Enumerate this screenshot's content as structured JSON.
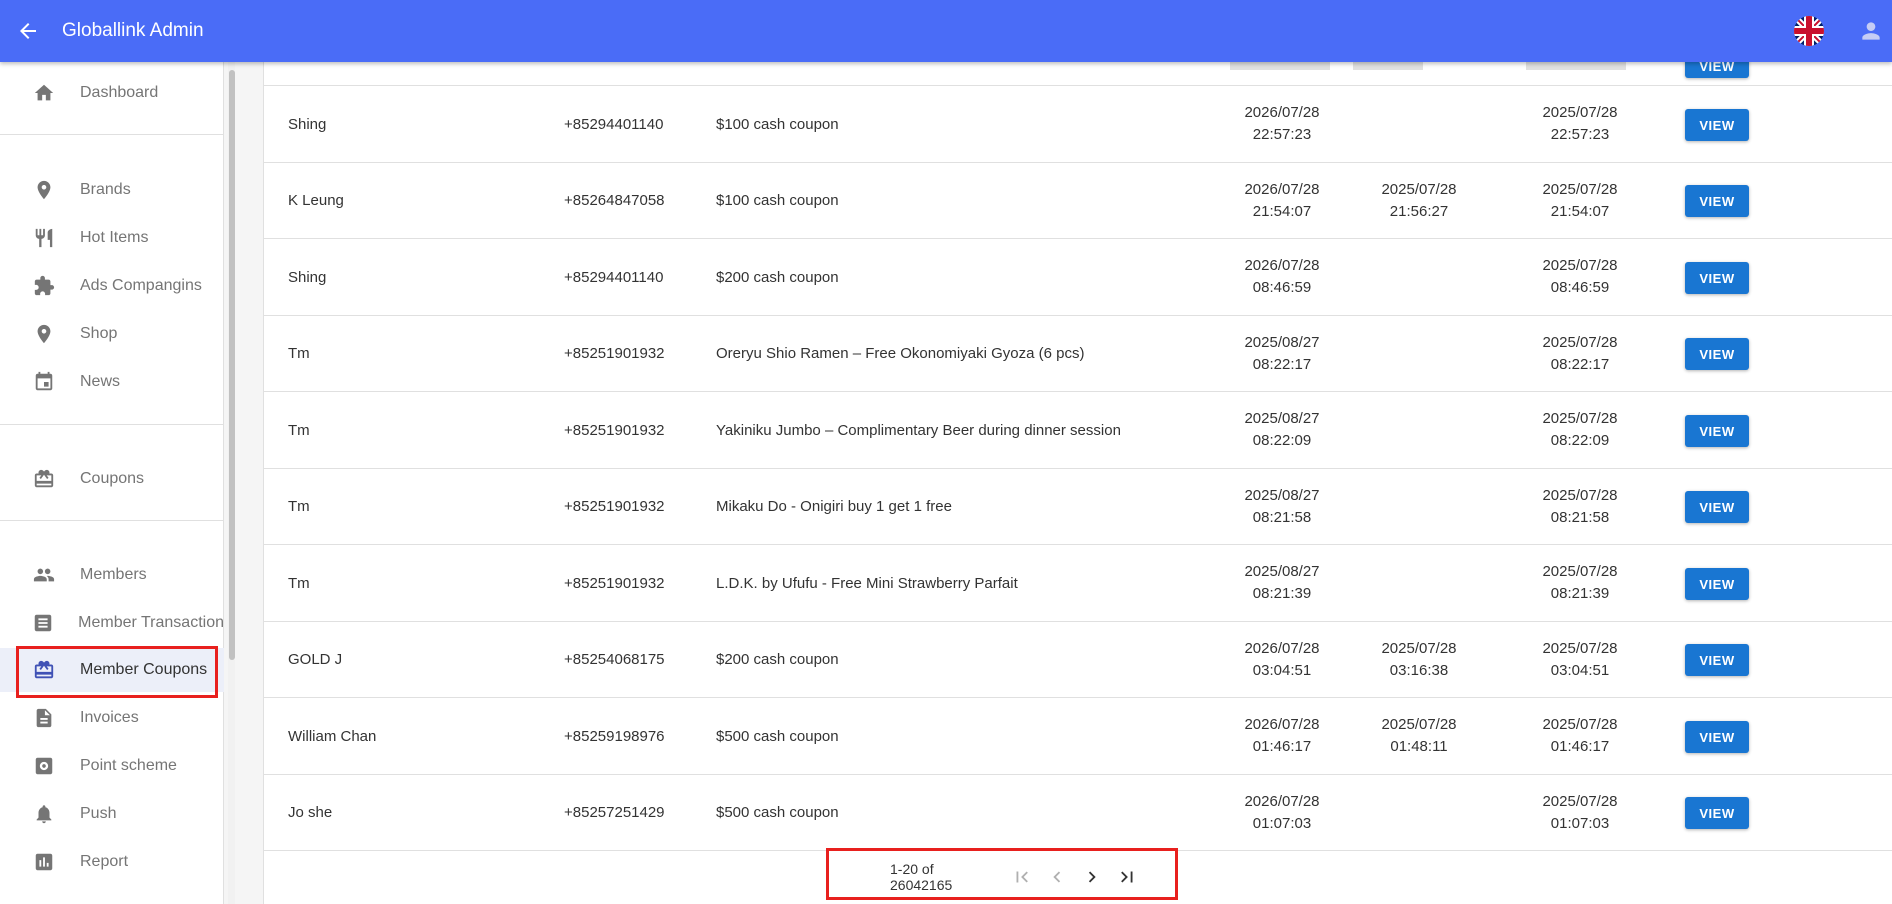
{
  "app": {
    "title": "Globallink Admin"
  },
  "header": {
    "back_icon": "arrow-left-icon",
    "flag_icon": "uk-flag-icon",
    "user_icon": "user-icon"
  },
  "sidebar": {
    "items": [
      {
        "label": "Dashboard",
        "icon": "home-icon"
      },
      {
        "label": "Brands",
        "icon": "location-pin-icon"
      },
      {
        "label": "Hot Items",
        "icon": "restaurant-icon"
      },
      {
        "label": "Ads Compangins",
        "icon": "puzzle-icon"
      },
      {
        "label": "Shop",
        "icon": "location-pin-icon"
      },
      {
        "label": "News",
        "icon": "calendar-icon"
      },
      {
        "label": "Coupons",
        "icon": "gift-card-icon"
      },
      {
        "label": "Members",
        "icon": "people-icon"
      },
      {
        "label": "Member Transaction",
        "icon": "list-icon"
      },
      {
        "label": "Member Coupons",
        "icon": "gift-card-icon",
        "active": true
      },
      {
        "label": "Invoices",
        "icon": "document-icon"
      },
      {
        "label": "Point scheme",
        "icon": "settings-box-icon"
      },
      {
        "label": "Push",
        "icon": "bell-icon"
      },
      {
        "label": "Report",
        "icon": "bar-chart-icon"
      }
    ]
  },
  "table": {
    "button_label": "VIEW",
    "rows": [
      {
        "name": "Shing",
        "phone": "+85294401140",
        "coupon": "$100 cash coupon",
        "expiry": [
          "2026/07/28",
          "22:57:23"
        ],
        "used": [
          "",
          ""
        ],
        "created": [
          "2025/07/28",
          "22:57:23"
        ]
      },
      {
        "name": "K Leung",
        "phone": "+85264847058",
        "coupon": "$100 cash coupon",
        "expiry": [
          "2026/07/28",
          "21:54:07"
        ],
        "used": [
          "2025/07/28",
          "21:56:27"
        ],
        "created": [
          "2025/07/28",
          "21:54:07"
        ]
      },
      {
        "name": "Shing",
        "phone": "+85294401140",
        "coupon": "$200 cash coupon",
        "expiry": [
          "2026/07/28",
          "08:46:59"
        ],
        "used": [
          "",
          ""
        ],
        "created": [
          "2025/07/28",
          "08:46:59"
        ]
      },
      {
        "name": "Tm",
        "phone": "+85251901932",
        "coupon": "Oreryu Shio Ramen – Free Okonomiyaki Gyoza (6 pcs)",
        "expiry": [
          "2025/08/27",
          "08:22:17"
        ],
        "used": [
          "",
          ""
        ],
        "created": [
          "2025/07/28",
          "08:22:17"
        ]
      },
      {
        "name": "Tm",
        "phone": "+85251901932",
        "coupon": "Yakiniku Jumbo – Complimentary Beer during dinner session",
        "expiry": [
          "2025/08/27",
          "08:22:09"
        ],
        "used": [
          "",
          ""
        ],
        "created": [
          "2025/07/28",
          "08:22:09"
        ]
      },
      {
        "name": "Tm",
        "phone": "+85251901932",
        "coupon": "Mikaku Do - Onigiri buy 1 get 1 free",
        "expiry": [
          "2025/08/27",
          "08:21:58"
        ],
        "used": [
          "",
          ""
        ],
        "created": [
          "2025/07/28",
          "08:21:58"
        ]
      },
      {
        "name": "Tm",
        "phone": "+85251901932",
        "coupon": "L.D.K. by Ufufu - Free Mini Strawberry Parfait",
        "expiry": [
          "2025/08/27",
          "08:21:39"
        ],
        "used": [
          "",
          ""
        ],
        "created": [
          "2025/07/28",
          "08:21:39"
        ]
      },
      {
        "name": "GOLD J",
        "phone": "+85254068175",
        "coupon": "$200 cash coupon",
        "expiry": [
          "2026/07/28",
          "03:04:51"
        ],
        "used": [
          "2025/07/28",
          "03:16:38"
        ],
        "created": [
          "2025/07/28",
          "03:04:51"
        ]
      },
      {
        "name": "William Chan",
        "phone": "+85259198976",
        "coupon": "$500 cash coupon",
        "expiry": [
          "2026/07/28",
          "01:46:17"
        ],
        "used": [
          "2025/07/28",
          "01:48:11"
        ],
        "created": [
          "2025/07/28",
          "01:46:17"
        ]
      },
      {
        "name": "Jo she",
        "phone": "+85257251429",
        "coupon": "$500 cash coupon",
        "expiry": [
          "2026/07/28",
          "01:07:03"
        ],
        "used": [
          "",
          ""
        ],
        "created": [
          "2025/07/28",
          "01:07:03"
        ]
      }
    ]
  },
  "pagination": {
    "range": "1-20 of 26042165"
  }
}
